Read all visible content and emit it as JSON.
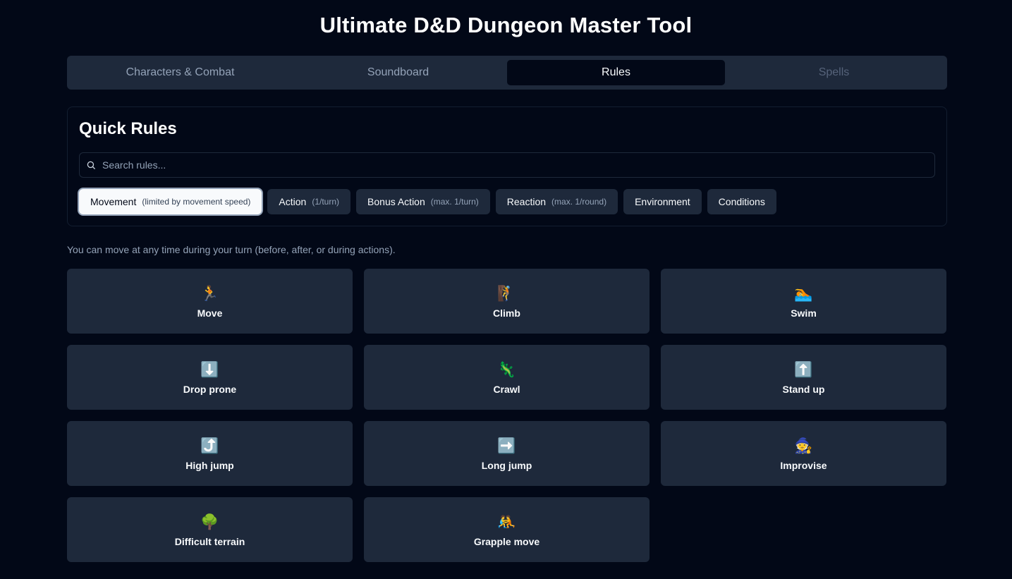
{
  "app": {
    "title": "Ultimate D&D Dungeon Master Tool"
  },
  "tabs": [
    {
      "label": "Characters & Combat",
      "state": "normal"
    },
    {
      "label": "Soundboard",
      "state": "normal"
    },
    {
      "label": "Rules",
      "state": "active"
    },
    {
      "label": "Spells",
      "state": "disabled"
    }
  ],
  "rules": {
    "title": "Quick Rules",
    "search": {
      "placeholder": "Search rules...",
      "value": ""
    },
    "categories": [
      {
        "label": "Movement",
        "note": "(limited by movement speed)",
        "active": true
      },
      {
        "label": "Action",
        "note": "(1/turn)",
        "active": false
      },
      {
        "label": "Bonus Action",
        "note": "(max. 1/turn)",
        "active": false
      },
      {
        "label": "Reaction",
        "note": "(max. 1/round)",
        "active": false
      },
      {
        "label": "Environment",
        "note": "",
        "active": false
      },
      {
        "label": "Conditions",
        "note": "",
        "active": false
      }
    ],
    "description": "You can move at any time during your turn (before, after, or during actions).",
    "actions": [
      {
        "label": "Move",
        "icon": "🏃",
        "icon_name": "running-icon"
      },
      {
        "label": "Climb",
        "icon": "🧗",
        "icon_name": "climbing-icon"
      },
      {
        "label": "Swim",
        "icon": "🏊",
        "icon_name": "swimming-icon"
      },
      {
        "label": "Drop prone",
        "icon": "⬇️",
        "icon_name": "down-arrow-icon"
      },
      {
        "label": "Crawl",
        "icon": "🦎",
        "icon_name": "lizard-icon"
      },
      {
        "label": "Stand up",
        "icon": "⬆️",
        "icon_name": "up-arrow-icon"
      },
      {
        "label": "High jump",
        "icon": "⤴️",
        "icon_name": "curved-up-arrow-icon"
      },
      {
        "label": "Long jump",
        "icon": "➡️",
        "icon_name": "right-arrow-icon"
      },
      {
        "label": "Improvise",
        "icon": "🧙",
        "icon_name": "wizard-icon"
      },
      {
        "label": "Difficult terrain",
        "icon": "🌳",
        "icon_name": "tree-icon"
      },
      {
        "label": "Grapple move",
        "icon": "🤼",
        "icon_name": "wrestling-icon"
      }
    ]
  },
  "colors": {
    "background": "#020817",
    "surface": "#1e293b",
    "text": "#f8fafc",
    "muted": "#94a3b8"
  }
}
